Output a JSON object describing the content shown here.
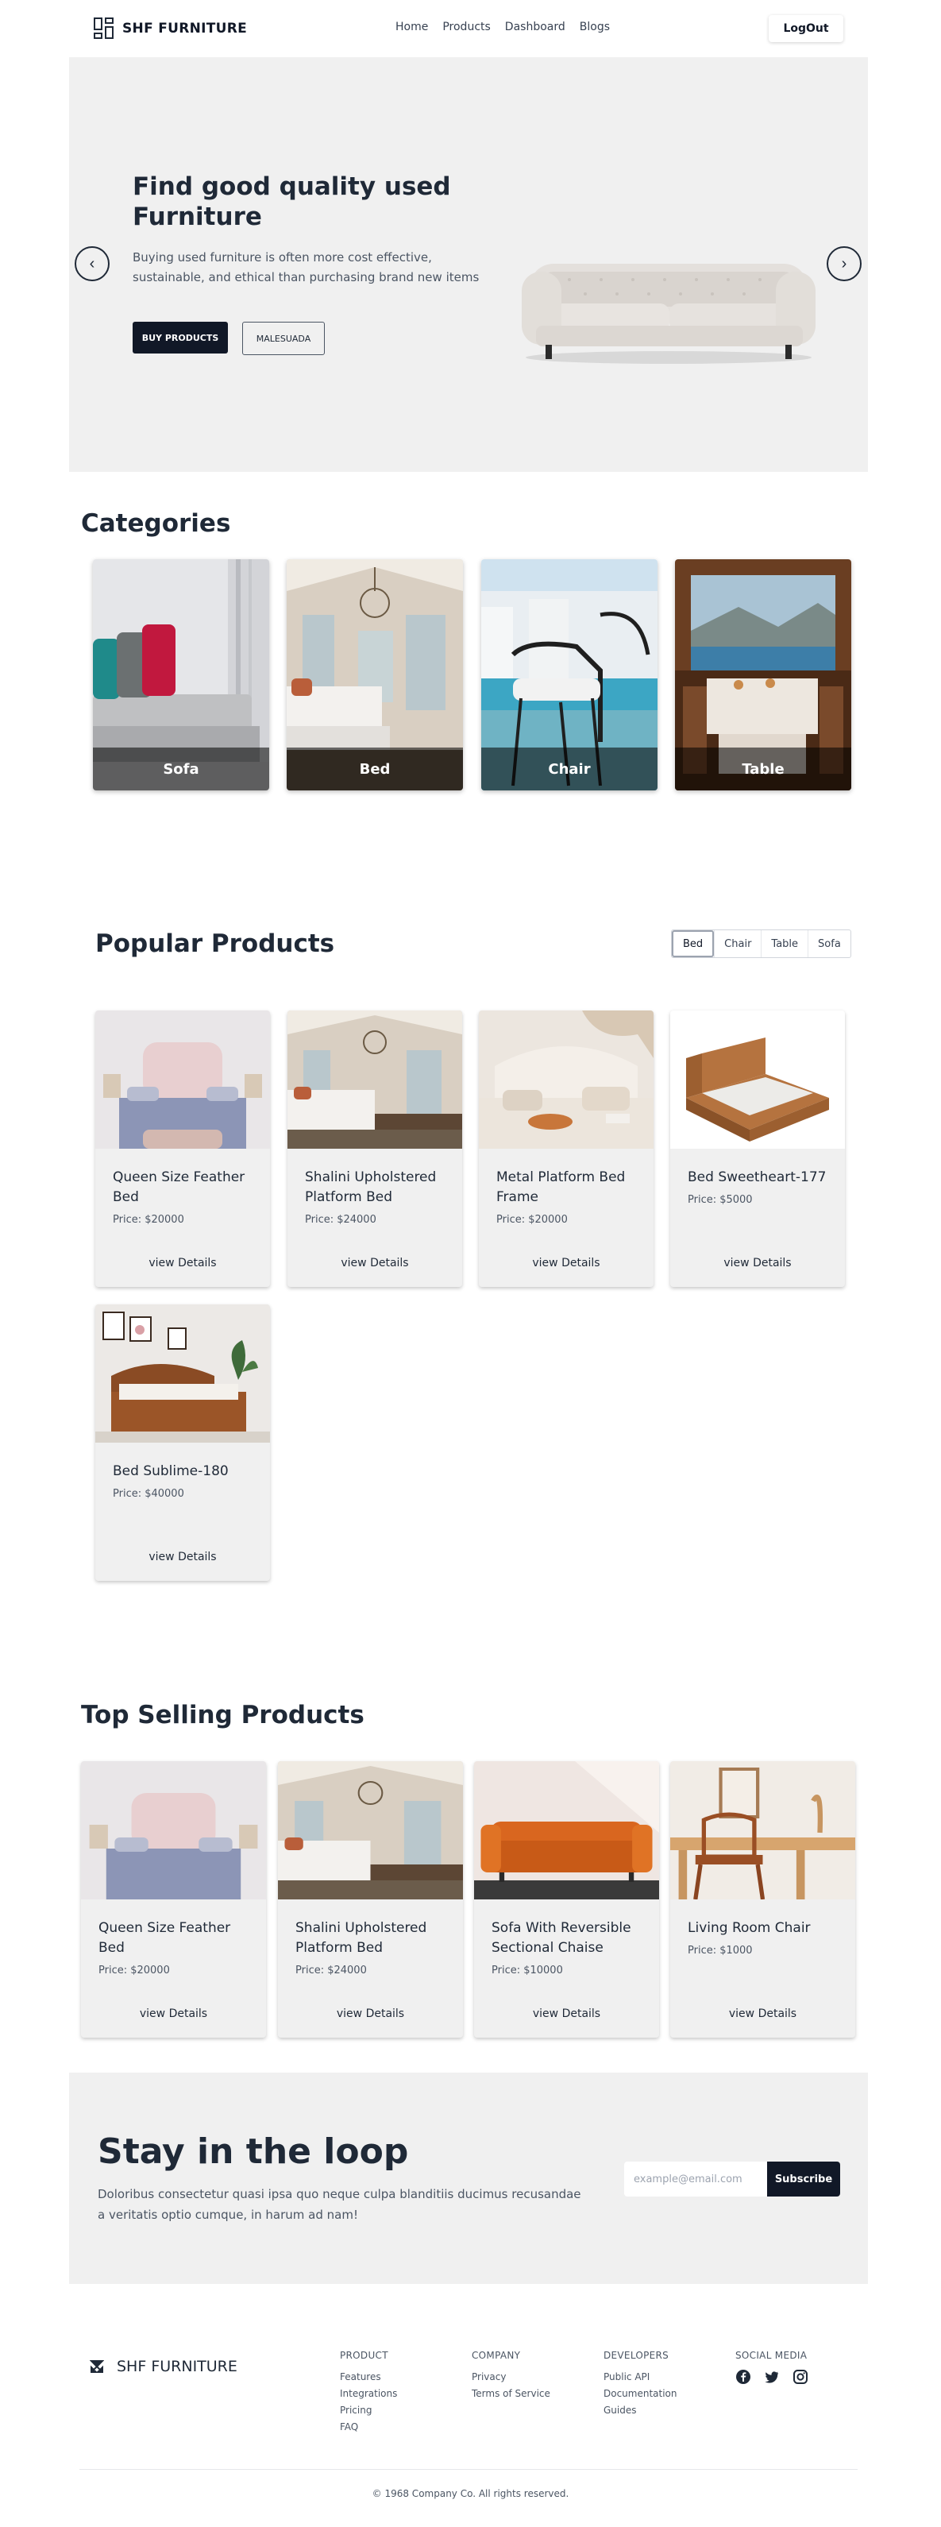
{
  "nav": {
    "brand": "SHF FURNITURE",
    "links": [
      "Home",
      "Products",
      "Dashboard",
      "Blogs"
    ],
    "logout": "LogOut"
  },
  "hero": {
    "title": "Find good quality used Furniture",
    "description": "Buying used furniture is often more cost effective, sustainable, and ethical than purchasing brand new items",
    "buy_button": "BUY PRODUCTS",
    "secondary_button": "MALESUADA",
    "prev_icon": "chevron-left-icon",
    "next_icon": "chevron-right-icon"
  },
  "categories": {
    "title": "Categories",
    "items": [
      "Sofa",
      "Bed",
      "Chair",
      "Table"
    ]
  },
  "popular": {
    "title": "Popular Products",
    "tabs": [
      "Bed",
      "Chair",
      "Table",
      "Sofa"
    ],
    "active_tab": "Bed",
    "products": [
      {
        "name": "Queen Size Feather Bed",
        "price": "Price: $20000",
        "action": "view Details"
      },
      {
        "name": "Shalini Upholstered Platform Bed",
        "price": "Price: $24000",
        "action": "view Details"
      },
      {
        "name": "Metal Platform Bed Frame",
        "price": "Price: $20000",
        "action": "view Details"
      },
      {
        "name": "Bed Sweetheart-177",
        "price": "Price: $5000",
        "action": "view Details"
      },
      {
        "name": "Bed Sublime-180",
        "price": "Price: $40000",
        "action": "view Details"
      }
    ]
  },
  "top_selling": {
    "title": "Top Selling Products",
    "products": [
      {
        "name": "Queen Size Feather Bed",
        "price": "Price: $20000",
        "action": "view Details"
      },
      {
        "name": "Shalini Upholstered Platform Bed",
        "price": "Price: $24000",
        "action": "view Details"
      },
      {
        "name": "Sofa With Reversible Sectional Chaise",
        "price": "Price: $10000",
        "action": "view Details"
      },
      {
        "name": "Living Room Chair",
        "price": "Price: $1000",
        "action": "view Details"
      }
    ]
  },
  "newsletter": {
    "title": "Stay in the loop",
    "description": "Doloribus consectetur quasi ipsa quo neque culpa blanditiis ducimus recusandae a veritatis optio cumque, in harum ad nam!",
    "placeholder": "example@email.com",
    "value": "",
    "button": "Subscribe"
  },
  "footer": {
    "brand": "SHF FURNITURE",
    "columns": [
      {
        "heading": "PRODUCT",
        "links": [
          "Features",
          "Integrations",
          "Pricing",
          "FAQ"
        ]
      },
      {
        "heading": "COMPANY",
        "links": [
          "Privacy",
          "Terms of Service"
        ]
      },
      {
        "heading": "DEVELOPERS",
        "links": [
          "Public API",
          "Documentation",
          "Guides"
        ]
      },
      {
        "heading": "SOCIAL MEDIA",
        "icons": [
          "facebook-icon",
          "twitter-icon",
          "instagram-icon"
        ]
      }
    ],
    "copyright": "© 1968 Company Co. All rights reserved."
  },
  "colors": {
    "primary_dark": "#111827",
    "panel_gray": "#f0f0f0",
    "text_dark": "#1f2937",
    "text_muted": "#4b5563"
  }
}
